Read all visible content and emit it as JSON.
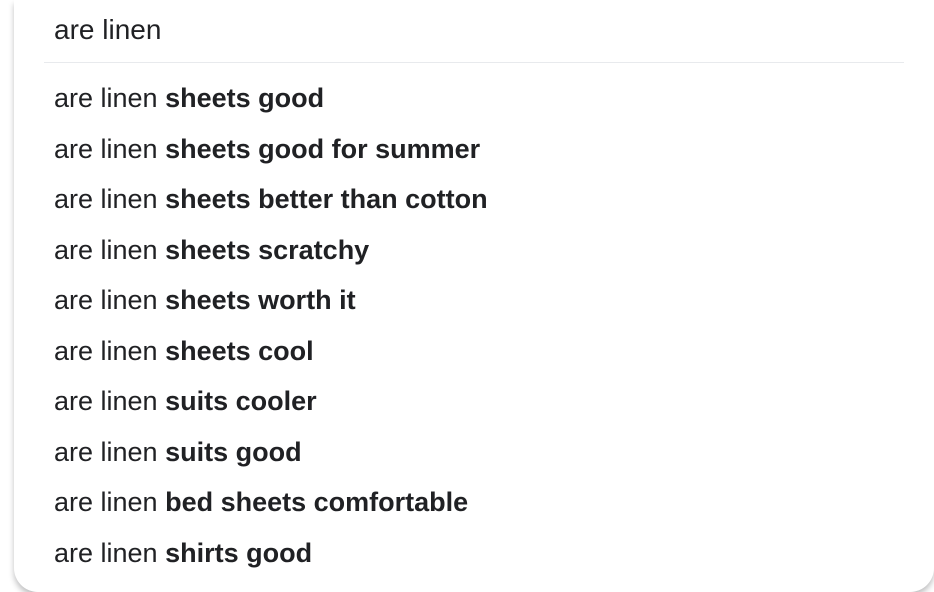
{
  "search": {
    "query": "are linen"
  },
  "suggestions": [
    {
      "prefix": "are linen ",
      "completion": "sheets good"
    },
    {
      "prefix": "are linen ",
      "completion": "sheets good for summer"
    },
    {
      "prefix": "are linen ",
      "completion": "sheets better than cotton"
    },
    {
      "prefix": "are linen ",
      "completion": "sheets scratchy"
    },
    {
      "prefix": "are linen ",
      "completion": "sheets worth it"
    },
    {
      "prefix": "are linen ",
      "completion": "sheets cool"
    },
    {
      "prefix": "are linen ",
      "completion": "suits cooler"
    },
    {
      "prefix": "are linen ",
      "completion": "suits good"
    },
    {
      "prefix": "are linen ",
      "completion": "bed sheets comfortable"
    },
    {
      "prefix": "are linen ",
      "completion": "shirts good"
    }
  ]
}
